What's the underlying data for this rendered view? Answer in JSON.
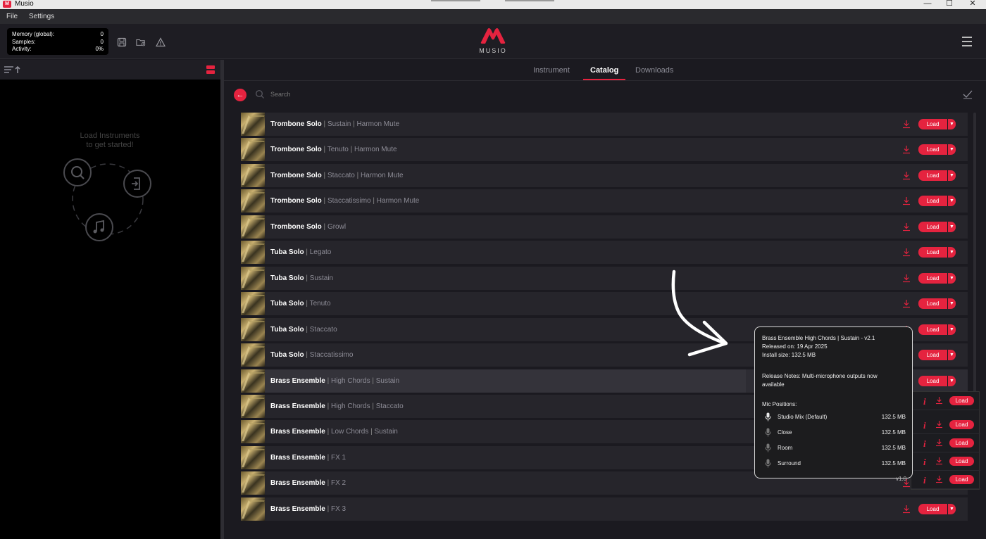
{
  "window": {
    "title": "Musio",
    "minimize": "—",
    "maximize": "☐",
    "close": "✕",
    "app_icon": "M"
  },
  "menu": {
    "file": "File",
    "settings": "Settings"
  },
  "stats": {
    "memory_label": "Memory (global):",
    "memory_value": "0",
    "samples_label": "Samples:",
    "samples_value": "0",
    "activity_label": "Activity:",
    "activity_value": "0%"
  },
  "logo": {
    "word": "MUSIO"
  },
  "sidebar": {
    "empty_text_line1": "Load Instruments",
    "empty_text_line2": "to get started!"
  },
  "tabs": {
    "instrument": "Instrument",
    "catalog": "Catalog",
    "downloads": "Downloads"
  },
  "search": {
    "placeholder": "Search"
  },
  "items": [
    {
      "name": "Trombone Solo",
      "art1": "Sustain",
      "art2": "Harmon Mute",
      "load": "Load"
    },
    {
      "name": "Trombone Solo",
      "art1": "Tenuto",
      "art2": "Harmon Mute",
      "load": "Load"
    },
    {
      "name": "Trombone Solo",
      "art1": "Staccato",
      "art2": "Harmon Mute",
      "load": "Load"
    },
    {
      "name": "Trombone Solo",
      "art1": "Staccatissimo",
      "art2": "Harmon Mute",
      "load": "Load"
    },
    {
      "name": "Trombone Solo",
      "art1": "Growl",
      "art2": "",
      "load": "Load"
    },
    {
      "name": "Tuba Solo",
      "art1": "Legato",
      "art2": "",
      "load": "Load"
    },
    {
      "name": "Tuba Solo",
      "art1": "Sustain",
      "art2": "",
      "load": "Load"
    },
    {
      "name": "Tuba Solo",
      "art1": "Tenuto",
      "art2": "",
      "load": "Load"
    },
    {
      "name": "Tuba Solo",
      "art1": "Staccato",
      "art2": "",
      "load": "Load"
    },
    {
      "name": "Tuba Solo",
      "art1": "Staccatissimo",
      "art2": "",
      "load": "Load"
    },
    {
      "name": "Brass Ensemble",
      "art1": "High Chords",
      "art2": "Sustain",
      "load": "Load"
    },
    {
      "name": "Brass Ensemble",
      "art1": "High Chords",
      "art2": "Staccato",
      "load": "Load"
    },
    {
      "name": "Brass Ensemble",
      "art1": "Low Chords",
      "art2": "Sustain",
      "load": "Load"
    },
    {
      "name": "Brass Ensemble",
      "art1": "FX 1",
      "art2": "",
      "load": "Load"
    },
    {
      "name": "Brass Ensemble",
      "art1": "FX 2",
      "art2": "",
      "load": "Load"
    },
    {
      "name": "Brass Ensemble",
      "art1": "FX 3",
      "art2": "",
      "load": "Load"
    }
  ],
  "popover": {
    "title": "Brass Ensemble High Chords | Sustain - v2.1",
    "released": "Released on: 19 Apr 2025",
    "install_size": "Install size: 132.5 MB",
    "notes": "Release Notes: Multi-microphone outputs now available",
    "mic_heading": "Mic Positions:",
    "mics": [
      {
        "name": "Studio Mix (Default)",
        "size": "132.5 MB"
      },
      {
        "name": "Close",
        "size": "132.5 MB"
      },
      {
        "name": "Room",
        "size": "132.5 MB"
      },
      {
        "name": "Surround",
        "size": "132.5 MB"
      }
    ]
  },
  "mic_panel": {
    "info": "i",
    "load": "Load"
  },
  "version": "v1.0",
  "colors": {
    "accent": "#e5233f",
    "background": "#1b1a20",
    "row": "#26252b"
  }
}
